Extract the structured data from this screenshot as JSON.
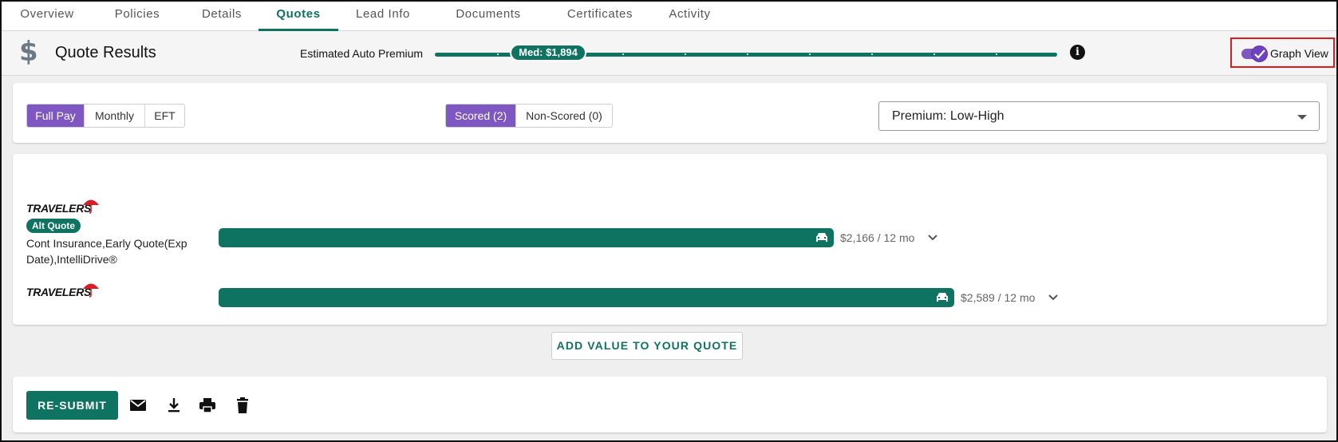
{
  "tabs": [
    {
      "label": "Overview",
      "active": false
    },
    {
      "label": "Policies",
      "active": false
    },
    {
      "label": "Details",
      "active": false
    },
    {
      "label": "Quotes",
      "active": true
    },
    {
      "label": "Lead Info",
      "active": false
    },
    {
      "label": "Documents",
      "active": false
    },
    {
      "label": "Certificates",
      "active": false
    },
    {
      "label": "Activity",
      "active": false
    }
  ],
  "header": {
    "icon": "dollar-icon",
    "title": "Quote Results",
    "estimate_label": "Estimated Auto Premium",
    "median_label": "Med: $1,894",
    "info_icon": "info-icon",
    "graph_view_label": "Graph View",
    "graph_view_on": true
  },
  "filters": {
    "payment_options": [
      {
        "label": "Full Pay",
        "active": true
      },
      {
        "label": "Monthly",
        "active": false
      },
      {
        "label": "EFT",
        "active": false
      }
    ],
    "score_options": [
      {
        "label": "Scored (2)",
        "active": true
      },
      {
        "label": "Non-Scored (0)",
        "active": false
      }
    ],
    "sort_value": "Premium: Low-High"
  },
  "quotes": [
    {
      "carrier": "TRAVELERS",
      "badge": "Alt Quote",
      "features": "Cont Insurance,Early Quote(Exp Date),IntelliDrive®",
      "price": "$2,166 / 12 mo",
      "premium": 2166
    },
    {
      "carrier": "TRAVELERS",
      "badge": "",
      "features": "",
      "price": "$2,589 / 12 mo",
      "premium": 2589
    }
  ],
  "add_value_label": "ADD VALUE TO YOUR QUOTE",
  "actions": {
    "resubmit_label": "RE-SUBMIT",
    "icons": [
      "email-icon",
      "download-icon",
      "print-icon",
      "delete-icon"
    ]
  },
  "colors": {
    "primary": "#0e7461",
    "accent": "#7e57c2",
    "highlight_box": "#e01b1b"
  }
}
